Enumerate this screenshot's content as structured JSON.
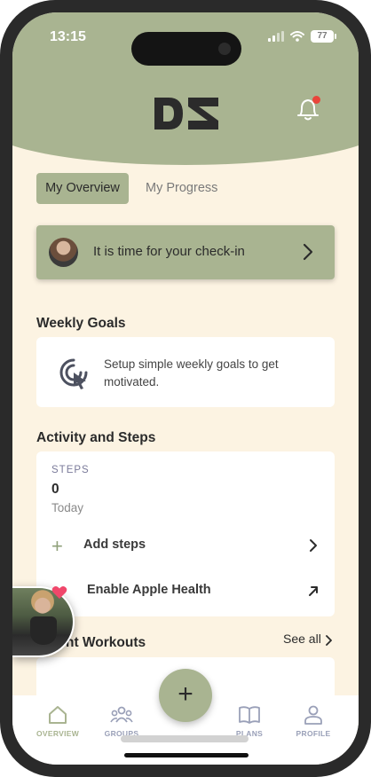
{
  "status": {
    "time": "13:15",
    "battery": "77"
  },
  "header": {
    "logo": "DS",
    "notification_icon": "bell-icon",
    "has_notification": true
  },
  "tabs": [
    {
      "label": "My Overview",
      "active": true
    },
    {
      "label": "My Progress",
      "active": false
    }
  ],
  "checkin": {
    "text": "It is time for your check-in"
  },
  "weekly_goals": {
    "title": "Weekly Goals",
    "text": "Setup simple weekly goals to get motivated."
  },
  "activity": {
    "title": "Activity and Steps",
    "steps_label": "STEPS",
    "steps_value": "0",
    "steps_period": "Today",
    "add_steps": "Add steps",
    "apple_health": "Enable Apple Health"
  },
  "workouts": {
    "title_partial": "nt Workouts",
    "see_all": "See all"
  },
  "tabbar": {
    "items": [
      {
        "label": "OVERVIEW",
        "icon": "home-icon",
        "active": true
      },
      {
        "label": "GROUPS",
        "icon": "groups-icon",
        "active": false
      },
      {
        "label": "PLANS",
        "icon": "book-icon",
        "active": false
      },
      {
        "label": "PROFILE",
        "icon": "profile-icon",
        "active": false
      }
    ],
    "fab_label": "+"
  },
  "colors": {
    "accent": "#a9b491",
    "background": "#fcf3e2",
    "alert": "#e9453b"
  }
}
